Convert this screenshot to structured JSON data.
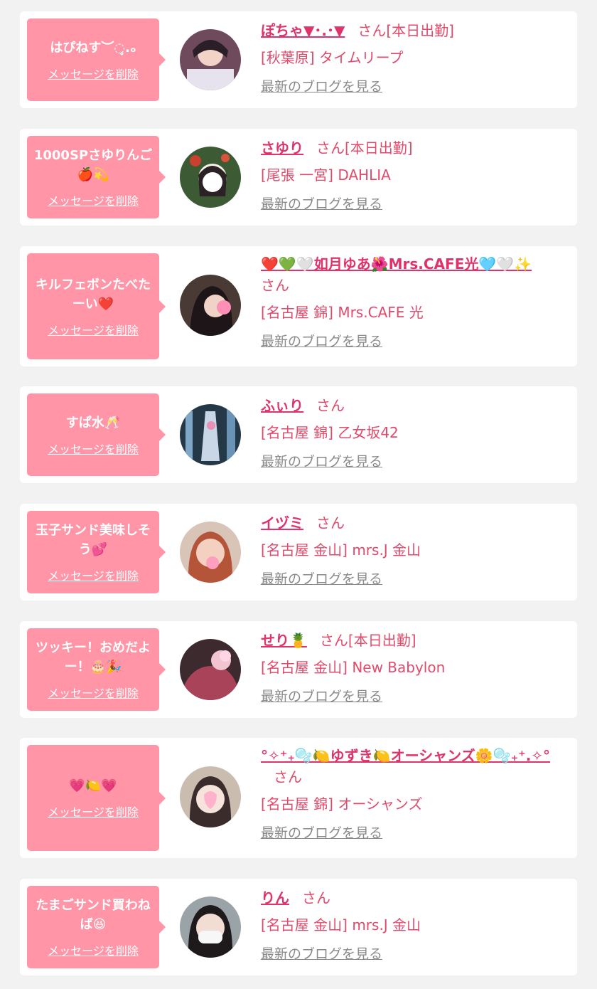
{
  "delete_label": "メッセージを削除",
  "blog_label": "最新のブログを見る",
  "san_label": "さん",
  "colors": {
    "bubble": "#ff95a6",
    "name": "#e0336a",
    "text": "#e24a6a",
    "blog": "#8a8a8a"
  },
  "cards": [
    {
      "message": "はぴねす︶◌̥.ₒ",
      "name": "ぽちゃ▼･.･▼",
      "status": "[本日出勤]",
      "shop": "[秋葉原] タイムリープ"
    },
    {
      "message": "1000SPさゆりんご🍎💫",
      "name": "さゆり",
      "status": "[本日出勤]",
      "shop": "[尾張 一宮] DAHLIA"
    },
    {
      "message": "キルフェボンたべたーい❤️",
      "name": "❤️💚🤍如月ゆあ🌺Mrs.CAFE光🩵🤍✨",
      "status": "",
      "shop": "[名古屋 錦] Mrs.CAFE 光"
    },
    {
      "message": "すぱ水🥂",
      "name": "ふぃり",
      "status": "",
      "shop": "[名古屋 錦] 乙女坂42"
    },
    {
      "message": "玉子サンド美味しそう💕",
      "name": "イヅミ",
      "status": "",
      "shop": "[名古屋 金山] mrs.J 金山"
    },
    {
      "message": "ツッキー！おめだよー！🎂🎉",
      "name": "せり🍍",
      "status": "[本日出勤]",
      "shop": "[名古屋 金山] New Babylon"
    },
    {
      "message": "💗🍋💗",
      "name": "°✧⁺₊🫧🍋ゆずき🍋オーシャンズ🌼🫧₊⁺.✧°",
      "status": "",
      "shop": "[名古屋 錦] オーシャンズ"
    },
    {
      "message": "たまごサンド買わねば😆",
      "name": "りん",
      "status": "",
      "shop": "[名古屋 金山] mrs.J 金山"
    }
  ]
}
